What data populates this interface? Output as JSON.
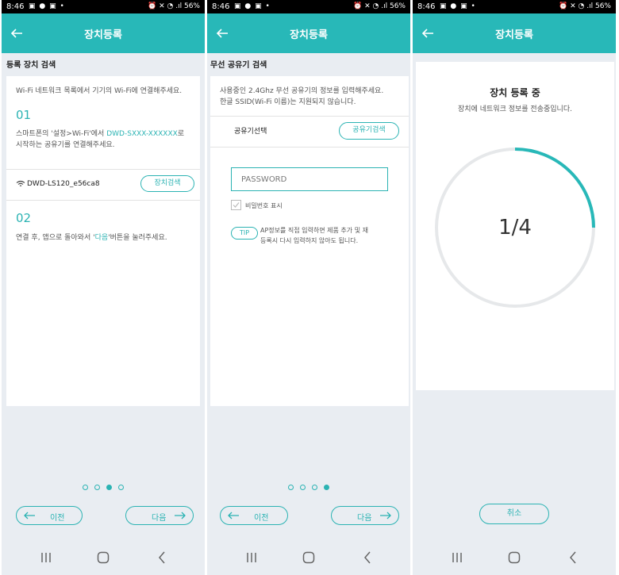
{
  "status_bar": {
    "time": "8:46",
    "icons_left": "▣ ● ▣ •",
    "icons_right": "⏰ ✕ ◔ .ıl 56%"
  },
  "app": {
    "title": "장치등록"
  },
  "screen1": {
    "section_title": "등록 장치 검색",
    "intro": "Wi-Fi 네트워크 목록에서 기기의 Wi-Fi에 연결해주세요.",
    "step1_num": "01",
    "step1_text_a": "스마트폰의 '설정>Wi-Fi'에서 ",
    "step1_text_link": "DWD-SXXX-XXXXXX",
    "step1_text_b": "로",
    "step1_text_c": "시작하는 공유기를 연결해주세요.",
    "device_name": "DWD-LS120_e56ca8",
    "search_button": "장치검색",
    "step2_num": "02",
    "step2_text_a": "연결 후, 앱으로 돌아와서 '",
    "step2_text_link": "다음",
    "step2_text_b": "'버튼을 눌러주세요.",
    "prev_button": "이전",
    "next_button": "다음"
  },
  "screen2": {
    "section_title": "무선 공유기 검색",
    "intro_line1": "사용중인 2.4Ghz 무선 공유기의 정보를 입력해주세요.",
    "intro_line2": "한글 SSID(Wi-Fi 이름)는 지원되지 않습니다.",
    "router_select_label": "공유기선택",
    "router_search_button": "공유기검색",
    "password_placeholder": "PASSWORD",
    "show_password_label": "비밀번호 표시",
    "tip_badge": "TIP",
    "tip_line1": "AP정보를 직접 입력하면 제품 추가 및 재",
    "tip_line2": "등록시 다시 입력하지 않아도 됩니다.",
    "prev_button": "이전",
    "next_button": "다음"
  },
  "screen3": {
    "heading": "장치 등록 중",
    "subtext": "장치에 네트워크 정보를 전송중입니다.",
    "progress_text": "1/4",
    "progress_fraction": 0.25,
    "cancel_button": "취소"
  },
  "pagination": {
    "screen1_active": 2,
    "screen2_active": 3,
    "total": 4
  },
  "colors": {
    "accent": "#28b8b8",
    "background": "#e9edf2",
    "track": "#e6e8ea"
  }
}
